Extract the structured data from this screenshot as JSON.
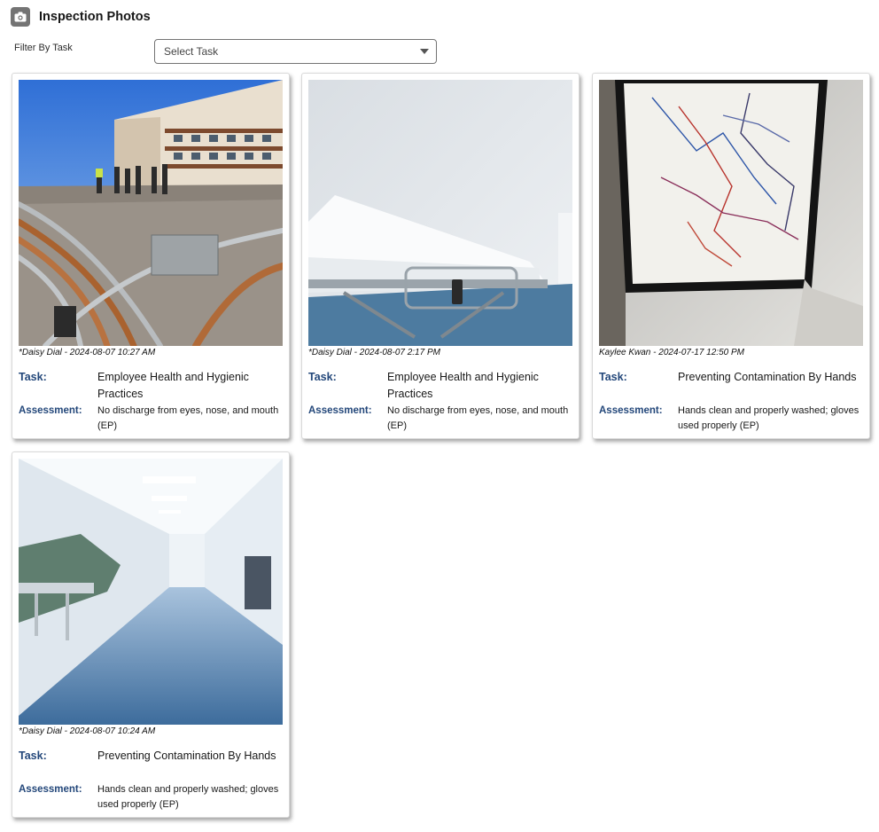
{
  "header": {
    "title": "Inspection Photos",
    "icon": "camera-icon"
  },
  "filter": {
    "label": "Filter By Task",
    "selected": "Select Task"
  },
  "labels": {
    "task": "Task:",
    "assessment": "Assessment:"
  },
  "cards": [
    {
      "caption": "*Daisy Dial - 2024-08-07 10:27 AM",
      "task": "Employee Health and Hygienic Practices",
      "assessment": "No discharge from eyes, nose, and mouth (EP)",
      "photo": "rooftop-photo"
    },
    {
      "caption": "*Daisy Dial - 2024-08-07 2:17 PM",
      "task": "Employee Health and Hygienic Practices",
      "assessment": "No discharge from eyes, nose, and mouth (EP)",
      "photo": "hospital-bed-photo"
    },
    {
      "caption": "Kaylee Kwan - 2024-07-17 12:50 PM",
      "task": "Preventing Contamination By Hands",
      "assessment": "Hands clean and properly washed; gloves used properly (EP)",
      "photo": "framed-map-photo"
    },
    {
      "caption": "*Daisy Dial - 2024-08-07 10:24 AM",
      "task": "Preventing Contamination By Hands",
      "assessment": "Hands clean and properly washed; gloves used properly (EP)",
      "photo": "hospital-corridor-photo"
    }
  ]
}
